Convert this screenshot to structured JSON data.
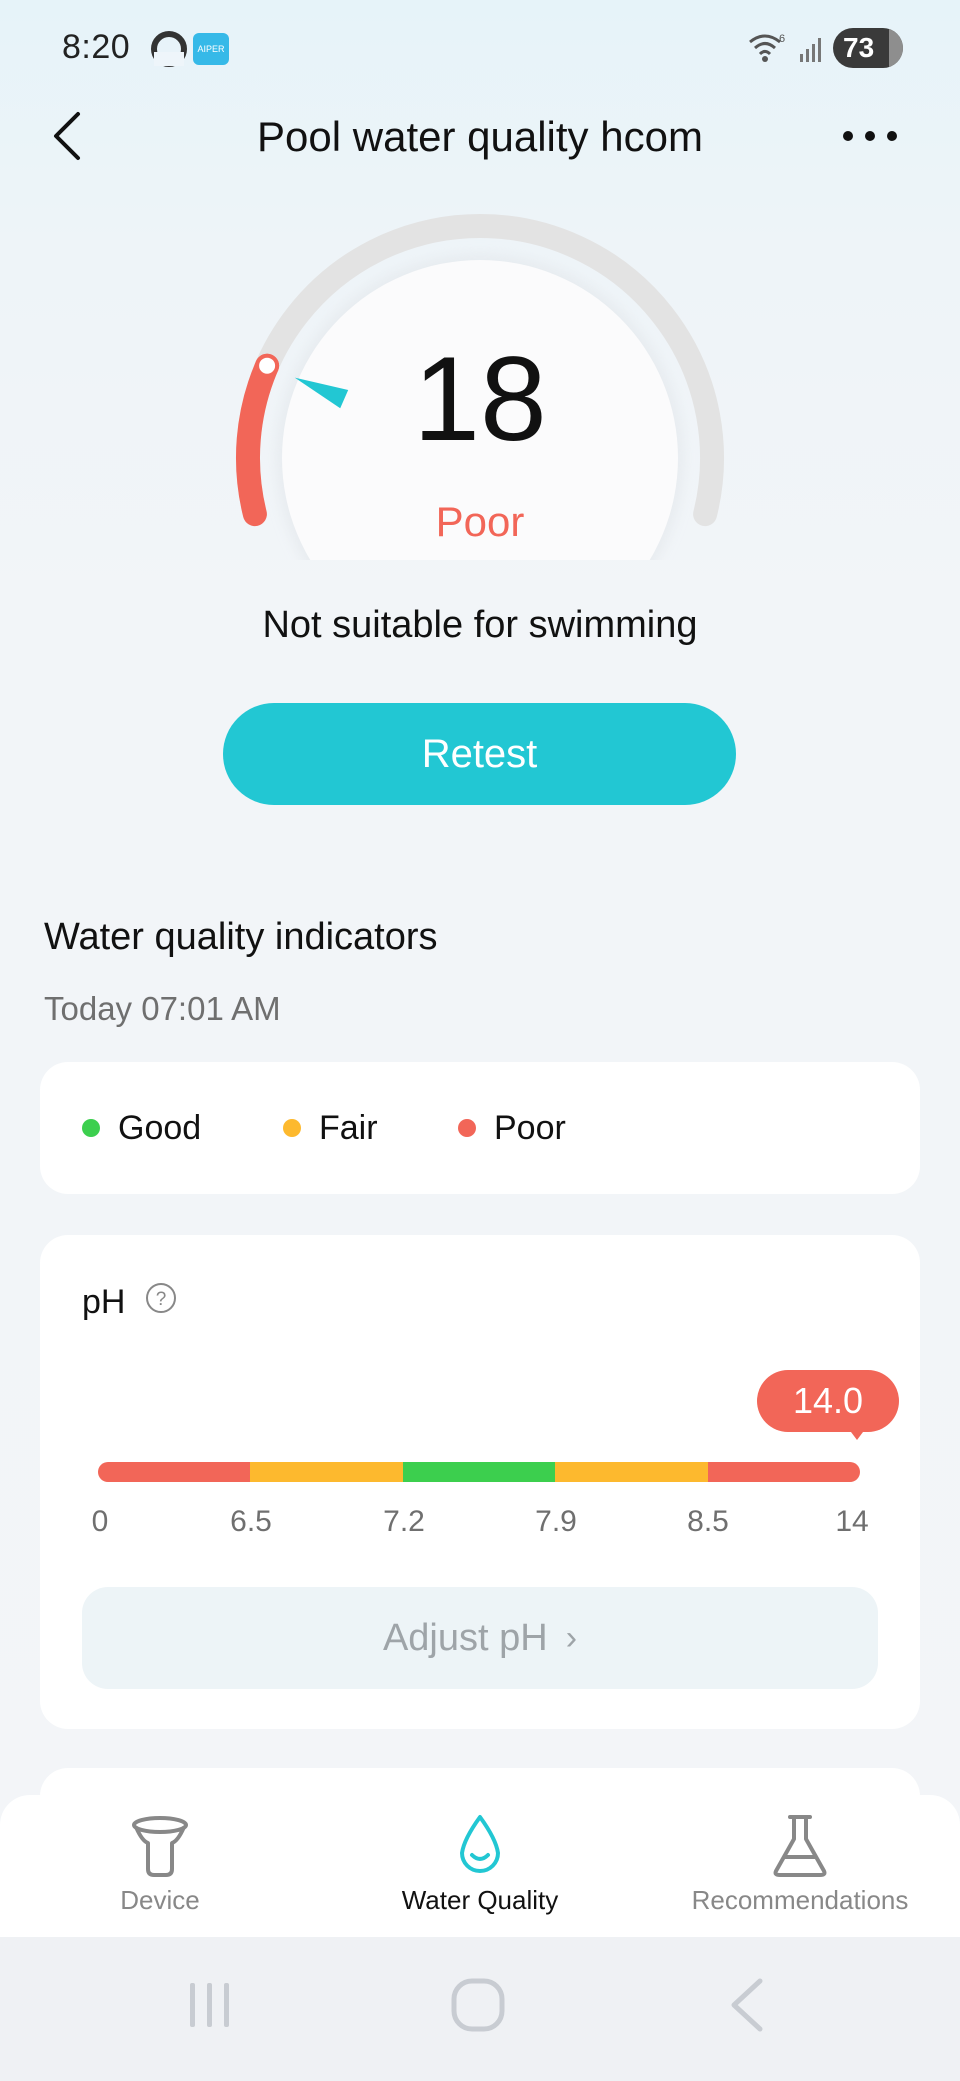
{
  "status_bar": {
    "time": "8:20",
    "app_badge": "AIPER",
    "battery_level": "73",
    "icons": [
      "app-ring-icon",
      "aiper-app-icon",
      "wifi-6-icon",
      "signal-bars-icon",
      "battery-icon"
    ]
  },
  "header": {
    "title": "Pool water quality hcom",
    "icons": [
      "back-chevron-icon",
      "more-dots-icon"
    ]
  },
  "gauge": {
    "score": "18",
    "score_value": 18,
    "score_max": 100,
    "grade": "Poor",
    "message": "Not suitable for swimming",
    "colors": {
      "track": "#e3e3e3",
      "progress": "#f26658",
      "pointer": "#22c7d3"
    }
  },
  "retest_label": "Retest",
  "indicators": {
    "title": "Water quality indicators",
    "timestamp": "Today 07:01 AM"
  },
  "legend": [
    {
      "label": "Good",
      "color": "#3ccf4e"
    },
    {
      "label": "Fair",
      "color": "#fdb92e"
    },
    {
      "label": "Poor",
      "color": "#f26658"
    }
  ],
  "ph": {
    "label": "pH",
    "value": "14.0",
    "ticks": [
      "0",
      "6.5",
      "7.2",
      "7.9",
      "8.5",
      "14"
    ],
    "segment_colors": [
      "#f26658",
      "#fdb92e",
      "#3ccf4e",
      "#fdb92e",
      "#f26658"
    ],
    "adjust_label": "Adjust pH",
    "adjust_chevron": "›"
  },
  "bottom_nav": {
    "items": [
      {
        "label": "Device",
        "icon": "skimmer-device-icon",
        "active": false
      },
      {
        "label": "Water Quality",
        "icon": "water-drop-icon",
        "active": true
      },
      {
        "label": "Recommendations",
        "icon": "flask-icon",
        "active": false
      }
    ]
  },
  "system_nav": {
    "icons": [
      "recent-apps-icon",
      "home-icon",
      "back-icon"
    ]
  }
}
